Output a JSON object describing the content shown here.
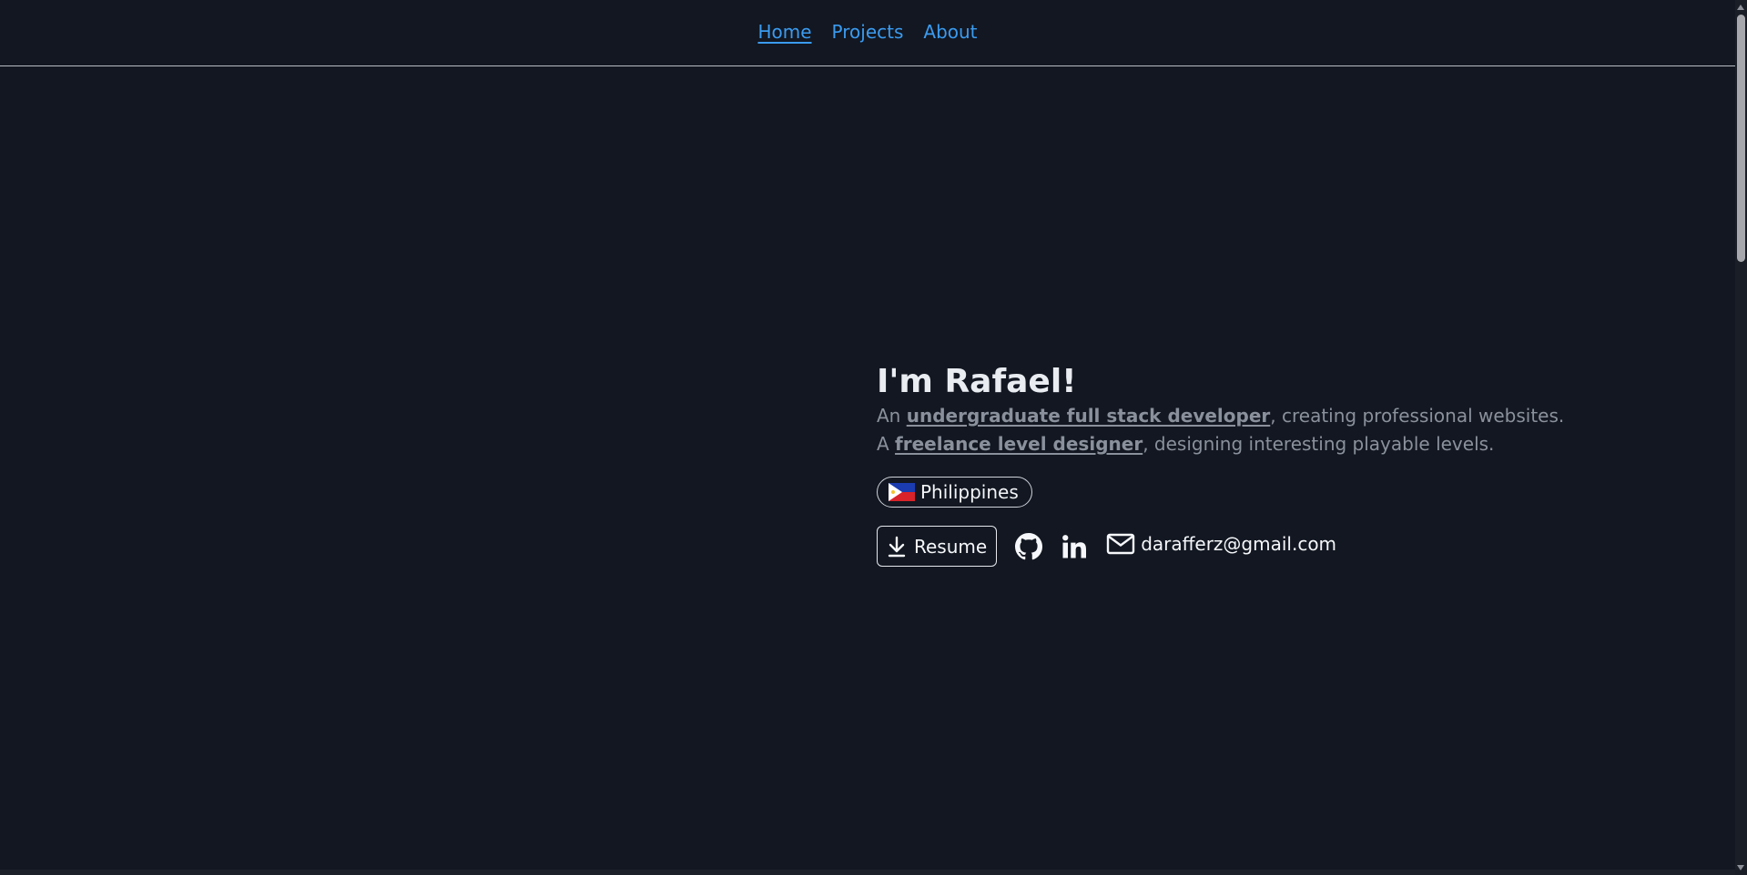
{
  "nav": {
    "items": [
      {
        "label": "Home",
        "active": true
      },
      {
        "label": "Projects",
        "active": false
      },
      {
        "label": "About",
        "active": false
      }
    ]
  },
  "hero": {
    "title": "I'm Rafael!",
    "line1": {
      "prefix": "An ",
      "highlight": "undergraduate full stack developer",
      "suffix": ", creating professional websites."
    },
    "line2": {
      "prefix": "A ",
      "highlight": "freelance level designer",
      "suffix": ", designing interesting playable levels."
    },
    "location": {
      "label": "Philippines",
      "icon": "philippines-flag-icon"
    },
    "actions": {
      "resume_label": "Resume",
      "resume_icon": "download-icon",
      "github_icon": "github-icon",
      "linkedin_icon": "linkedin-icon",
      "email_icon": "mail-icon",
      "email": "darafferz@gmail.com"
    }
  },
  "colors": {
    "background": "#121721",
    "link": "#3b9bf0",
    "heading": "#e9ecf1",
    "muted_text": "#8b919c"
  }
}
